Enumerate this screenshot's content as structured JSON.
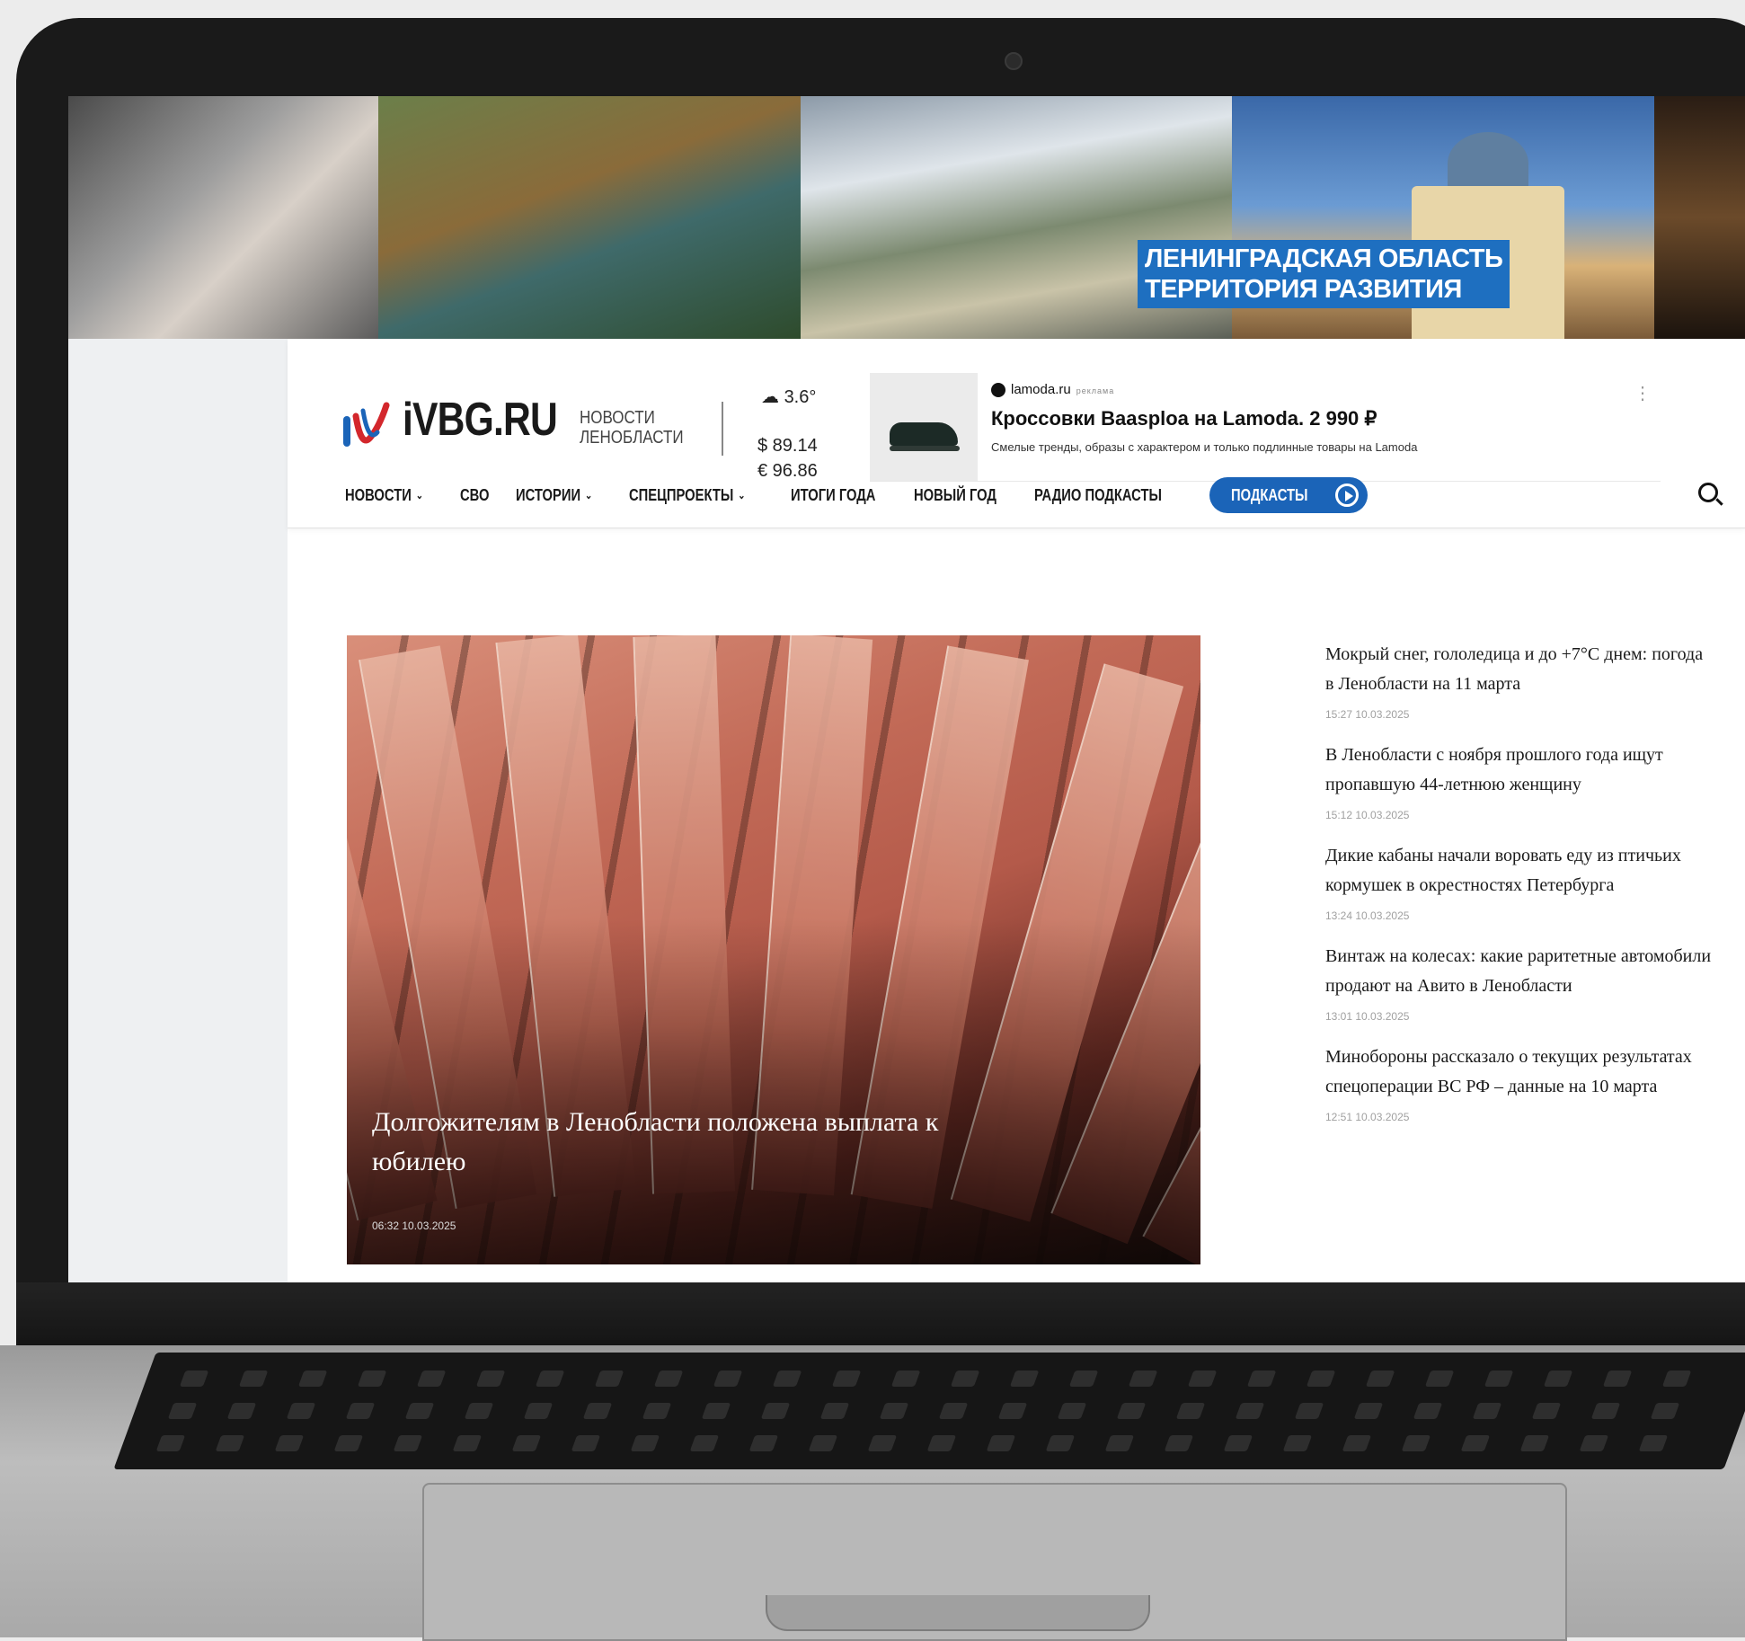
{
  "banner": {
    "line1": "ЛЕНИНГРАДСКАЯ ОБЛАСТЬ",
    "line2": "ТЕРРИТОРИЯ РАЗВИТИЯ"
  },
  "header": {
    "logo": "iVBG.RU",
    "tagline1": "НОВОСТИ",
    "tagline2": "ЛЕНОБЛАСТИ",
    "weather": "3.6°",
    "usd": "$ 89.14",
    "eur": "€ 96.86"
  },
  "ad": {
    "source": "lamoda.ru",
    "tag": "реклама",
    "title": "Кроссовки Baasploa на Lamoda. 2 990 ₽",
    "description": "Смелые тренды, образы с характером и только подлинные товары на Lamoda"
  },
  "nav": {
    "items": [
      {
        "label": "НОВОСТИ",
        "chevron": true
      },
      {
        "label": "СВО",
        "chevron": false
      },
      {
        "label": "ИСТОРИИ",
        "chevron": true
      },
      {
        "label": "СПЕЦПРОЕКТЫ",
        "chevron": true
      },
      {
        "label": "ИТОГИ ГОДА",
        "chevron": false
      },
      {
        "label": "НОВЫЙ ГОД",
        "chevron": false
      },
      {
        "label": "РАДИО ПОДКАСТЫ",
        "chevron": false
      }
    ],
    "podcast_button": "ПОДКАСТЫ"
  },
  "hero": {
    "title": "Долгожителям в Ленобласти положена выплата к юбилею",
    "date": "06:32 10.03.2025"
  },
  "news": [
    {
      "title": "Мокрый снег, гололедица и до +7°С днем: погода в Ленобласти на 11 марта",
      "time": "15:27 10.03.2025"
    },
    {
      "title": "В Ленобласти с ноября прошлого года ищут пропавшую 44-летнюю женщину",
      "time": "15:12 10.03.2025"
    },
    {
      "title": "Дикие кабаны начали воровать еду из птичьих кормушек в окрестностях Петербурга",
      "time": "13:24 10.03.2025"
    },
    {
      "title": "Винтаж на колесах: какие раритетные автомобили продают на Авито в Ленобласти",
      "time": "13:01 10.03.2025"
    },
    {
      "title": "Минобороны рассказало о текущих результатах спецоперации ВС РФ – данные на 10 марта",
      "time": "12:51 10.03.2025"
    }
  ]
}
